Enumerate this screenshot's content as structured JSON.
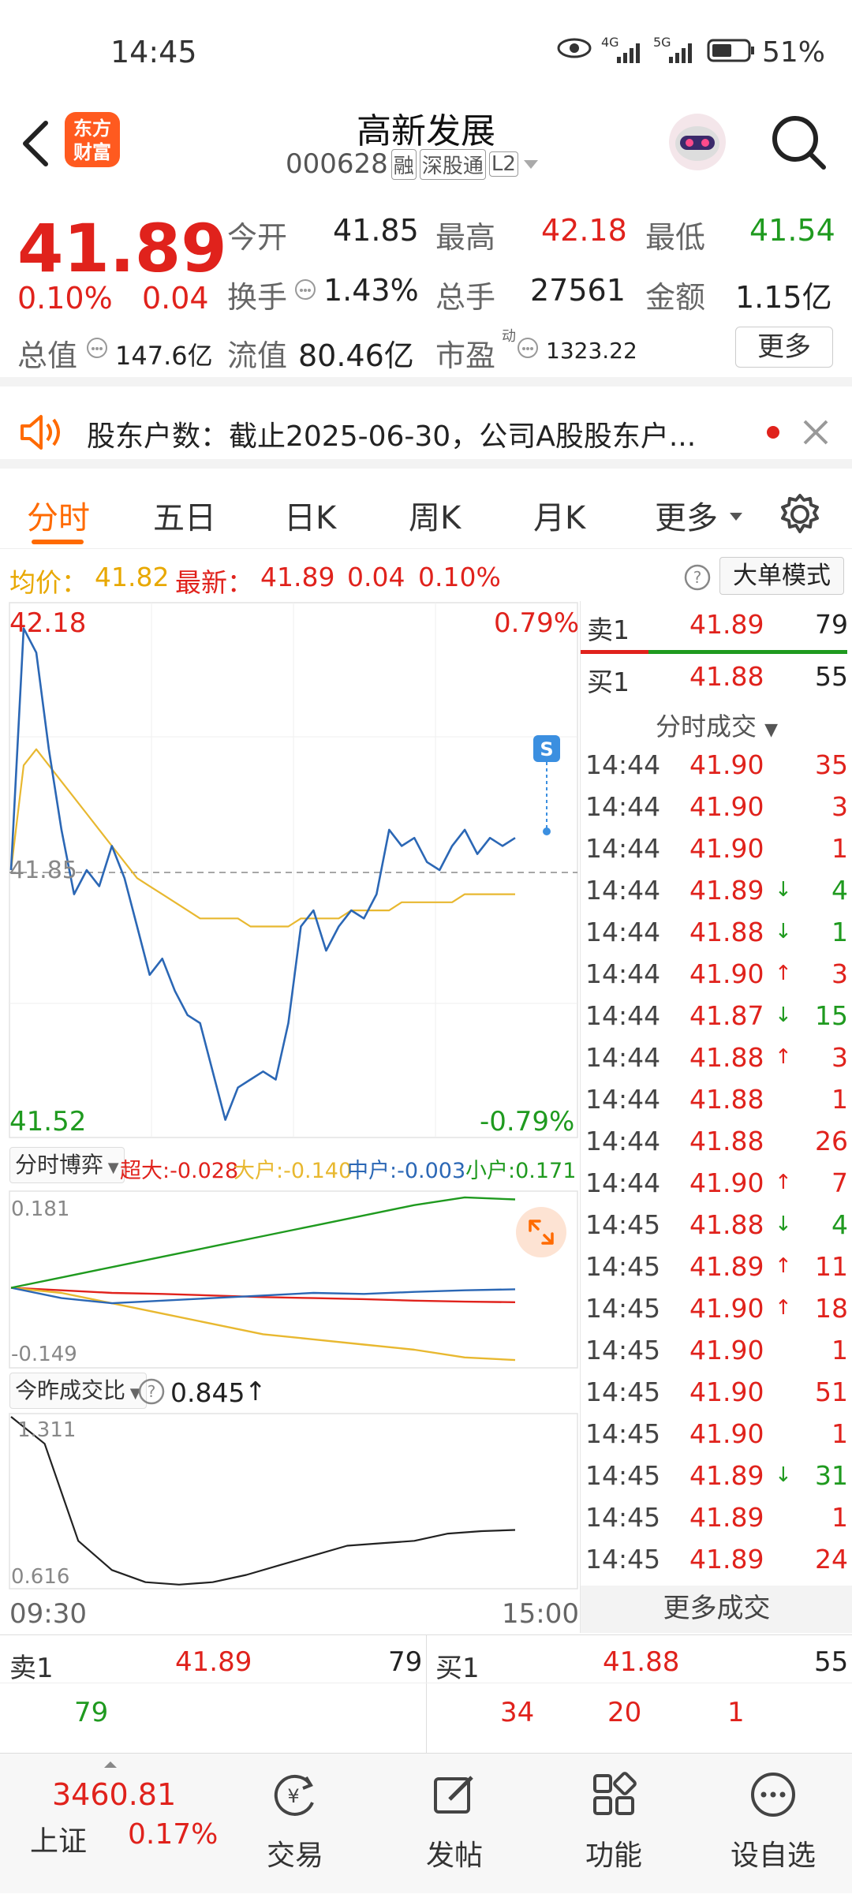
{
  "status": {
    "time": "14:45",
    "battery": "51%",
    "net1": "4G",
    "net2": "5G"
  },
  "header": {
    "title": "高新发展",
    "code": "000628",
    "tags": [
      "融",
      "深股通",
      "L2"
    ],
    "logo_text": "东方财富"
  },
  "quote": {
    "price": "41.89",
    "pct": "0.10%",
    "change": "0.04",
    "open_label": "今开",
    "open": "41.85",
    "high_label": "最高",
    "high": "42.18",
    "low_label": "最低",
    "low": "41.54",
    "turnover_label": "换手",
    "turnover": "1.43%",
    "volume_label": "总手",
    "volume": "27561",
    "amount_label": "金额",
    "amount": "1.15亿",
    "mktcap_label": "总值",
    "mktcap": "147.6亿",
    "float_label": "流值",
    "float": "80.46亿",
    "pe_label": "市盈",
    "pe_sup": "动",
    "pe": "1323.22",
    "more_button": "更多"
  },
  "notice": {
    "text": "股东户数：截止2025-06-30，公司A股股东户..."
  },
  "tabs": [
    "分时",
    "五日",
    "日K",
    "周K",
    "月K",
    "更多"
  ],
  "infobar": {
    "avg_label": "均价：",
    "avg": "41.82",
    "latest_label": "最新：",
    "latest": "41.89",
    "chg": "0.04",
    "pct": "0.10%",
    "mode_button": "大单模式"
  },
  "chart": {
    "top_price": "42.18",
    "top_pct": "0.79%",
    "bottom_price": "41.52",
    "bottom_pct": "-0.79%",
    "mid_price": "41.85",
    "s_marker": "S",
    "start_time": "09:30",
    "end_time": "15:00"
  },
  "chart_data": [
    {
      "type": "line",
      "title": "",
      "ylim": [
        41.52,
        42.18
      ],
      "prev_close": 41.85,
      "x": [
        "09:30",
        "15:00"
      ],
      "series": [
        {
          "values": [
            41.85,
            42.15,
            42.12,
            42.0,
            41.9,
            41.82,
            41.85,
            41.83,
            41.88,
            41.84,
            41.78,
            41.72,
            41.74,
            41.7,
            41.67,
            41.66,
            41.6,
            41.54,
            41.58,
            41.59,
            41.6,
            41.59,
            41.66,
            41.78,
            41.8,
            41.75,
            41.78,
            41.8,
            41.79,
            41.82,
            41.9,
            41.88,
            41.89,
            41.86,
            41.85,
            41.88,
            41.9,
            41.87,
            41.89,
            41.88,
            41.89
          ]
        },
        {
          "values": [
            41.85,
            41.98,
            42.0,
            41.98,
            41.96,
            41.94,
            41.92,
            41.9,
            41.88,
            41.86,
            41.84,
            41.83,
            41.82,
            41.81,
            41.8,
            41.79,
            41.79,
            41.79,
            41.79,
            41.78,
            41.78,
            41.78,
            41.78,
            41.79,
            41.79,
            41.79,
            41.79,
            41.8,
            41.8,
            41.8,
            41.8,
            41.81,
            41.81,
            41.81,
            41.81,
            41.81,
            41.82,
            41.82,
            41.82,
            41.82,
            41.82
          ]
        }
      ]
    },
    {
      "type": "line",
      "title": "",
      "ylim": [
        -0.149,
        0.181
      ],
      "series": [
        {
          "name": "超大",
          "values": [
            0.0,
            -0.005,
            -0.01,
            -0.012,
            -0.015,
            -0.018,
            -0.02,
            -0.022,
            -0.025,
            -0.027,
            -0.028
          ]
        },
        {
          "name": "大户",
          "values": [
            0.0,
            -0.01,
            -0.03,
            -0.05,
            -0.07,
            -0.09,
            -0.1,
            -0.11,
            -0.12,
            -0.135,
            -0.14
          ]
        },
        {
          "name": "中户",
          "values": [
            0.0,
            -0.02,
            -0.03,
            -0.025,
            -0.02,
            -0.015,
            -0.01,
            -0.012,
            -0.008,
            -0.005,
            -0.003
          ]
        },
        {
          "name": "小户",
          "values": [
            0.0,
            0.02,
            0.04,
            0.06,
            0.08,
            0.1,
            0.12,
            0.14,
            0.16,
            0.175,
            0.171
          ]
        }
      ]
    },
    {
      "type": "line",
      "title": "",
      "ylim": [
        0.616,
        1.311
      ],
      "series": [
        {
          "values": [
            1.311,
            1.2,
            0.8,
            0.68,
            0.63,
            0.62,
            0.63,
            0.66,
            0.7,
            0.74,
            0.78,
            0.79,
            0.8,
            0.83,
            0.84,
            0.845
          ]
        }
      ]
    }
  ],
  "fenshi": {
    "label": "分时博弈",
    "chaoda": "超大:-0.028",
    "dahu": "大户:-0.140",
    "zhonghu": "中户:-0.003",
    "xiaohu": "小户:0.171",
    "top": "0.181",
    "bottom": "-0.149"
  },
  "ratio": {
    "label": "今昨成交比",
    "value": "0.845",
    "arrow": "↑",
    "top": "1.311",
    "bottom": "0.616"
  },
  "orderbook": {
    "sell_label": "卖1",
    "sell_price": "41.89",
    "sell_vol": "79",
    "buy_label": "买1",
    "buy_price": "41.88",
    "buy_vol": "55",
    "ticks_header": "分时成交",
    "more_trades": "更多成交"
  },
  "trades": [
    {
      "t": "14:44",
      "p": "41.90",
      "v": "35",
      "pc": "red",
      "vc": "red",
      "a": ""
    },
    {
      "t": "14:44",
      "p": "41.90",
      "v": "3",
      "pc": "red",
      "vc": "red",
      "a": ""
    },
    {
      "t": "14:44",
      "p": "41.90",
      "v": "1",
      "pc": "red",
      "vc": "red",
      "a": ""
    },
    {
      "t": "14:44",
      "p": "41.89",
      "v": "4",
      "pc": "red",
      "vc": "green",
      "a": "↓"
    },
    {
      "t": "14:44",
      "p": "41.88",
      "v": "1",
      "pc": "red",
      "vc": "green",
      "a": "↓"
    },
    {
      "t": "14:44",
      "p": "41.90",
      "v": "3",
      "pc": "red",
      "vc": "red",
      "a": "↑"
    },
    {
      "t": "14:44",
      "p": "41.87",
      "v": "15",
      "pc": "red",
      "vc": "green",
      "a": "↓"
    },
    {
      "t": "14:44",
      "p": "41.88",
      "v": "3",
      "pc": "red",
      "vc": "red",
      "a": "↑"
    },
    {
      "t": "14:44",
      "p": "41.88",
      "v": "1",
      "pc": "red",
      "vc": "red",
      "a": ""
    },
    {
      "t": "14:44",
      "p": "41.88",
      "v": "26",
      "pc": "red",
      "vc": "red",
      "a": ""
    },
    {
      "t": "14:44",
      "p": "41.90",
      "v": "7",
      "pc": "red",
      "vc": "red",
      "a": "↑"
    },
    {
      "t": "14:45",
      "p": "41.88",
      "v": "4",
      "pc": "red",
      "vc": "green",
      "a": "↓"
    },
    {
      "t": "14:45",
      "p": "41.89",
      "v": "11",
      "pc": "red",
      "vc": "red",
      "a": "↑"
    },
    {
      "t": "14:45",
      "p": "41.90",
      "v": "18",
      "pc": "red",
      "vc": "red",
      "a": "↑"
    },
    {
      "t": "14:45",
      "p": "41.90",
      "v": "1",
      "pc": "red",
      "vc": "red",
      "a": ""
    },
    {
      "t": "14:45",
      "p": "41.90",
      "v": "51",
      "pc": "red",
      "vc": "red",
      "a": ""
    },
    {
      "t": "14:45",
      "p": "41.90",
      "v": "1",
      "pc": "red",
      "vc": "red",
      "a": ""
    },
    {
      "t": "14:45",
      "p": "41.89",
      "v": "31",
      "pc": "red",
      "vc": "green",
      "a": "↓"
    },
    {
      "t": "14:45",
      "p": "41.89",
      "v": "1",
      "pc": "red",
      "vc": "red",
      "a": ""
    },
    {
      "t": "14:45",
      "p": "41.89",
      "v": "24",
      "pc": "red",
      "vc": "red",
      "a": ""
    }
  ],
  "bottom_book": {
    "sell_label": "卖1",
    "sell_price": "41.89",
    "sell_vol": "79",
    "sell_queue": [
      "79"
    ],
    "buy_label": "买1",
    "buy_price": "41.88",
    "buy_vol": "55",
    "buy_queue": [
      "34",
      "20",
      "1"
    ]
  },
  "nav": {
    "index_value": "3460.81",
    "index_name": "上证",
    "index_pct": "0.17%",
    "items": [
      "交易",
      "发帖",
      "功能",
      "设自选"
    ]
  },
  "colors": {
    "up": "#e0221c",
    "down": "#1f9a1f",
    "accent": "#ff6a00",
    "price_line": "#2b67b5",
    "avg_line": "#e8b830"
  }
}
